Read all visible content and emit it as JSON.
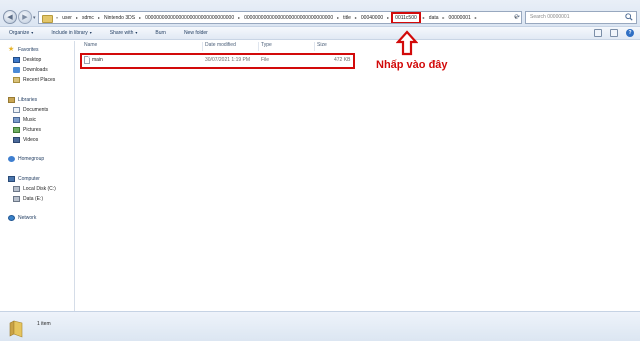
{
  "address": {
    "prefix": "«",
    "crumbs": [
      "user",
      "sdmc",
      "Nintendo 3DS",
      "00000000000000000000000000000000",
      "00000000000000000000000000000000",
      "title",
      "00040000",
      "0011c500",
      "data",
      "00000001"
    ],
    "highlight_index": 7
  },
  "search": {
    "placeholder": "Search 00000001"
  },
  "toolbar": {
    "organize": "Organize",
    "include": "Include in library",
    "share": "Share with",
    "burn": "Burn",
    "newfolder": "New folder"
  },
  "nav": {
    "favorites": "Favorites",
    "desktop": "Desktop",
    "downloads": "Downloads",
    "recent": "Recent Places",
    "libraries": "Libraries",
    "documents": "Documents",
    "music": "Music",
    "pictures": "Pictures",
    "videos": "Videos",
    "homegroup": "Homegroup",
    "computer": "Computer",
    "localdisk": "Local Disk (C:)",
    "data": "Data (E:)",
    "network": "Network"
  },
  "columns": {
    "name": "Name",
    "date": "Date modified",
    "type": "Type",
    "size": "Size"
  },
  "files": [
    {
      "name": "main",
      "date": "30/07/2021 1:19 PM",
      "type": "File",
      "size": "472 KB"
    }
  ],
  "annotation": {
    "text": "Nhấp vào đây",
    "color": "#d20a0a"
  },
  "status": {
    "items": "1 item"
  }
}
